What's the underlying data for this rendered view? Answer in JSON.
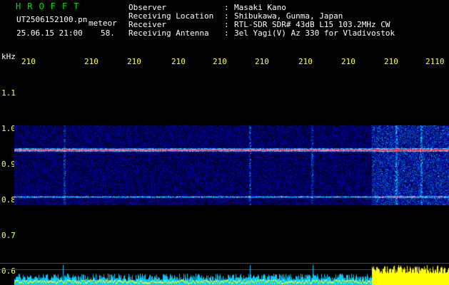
{
  "header": {
    "title": "HROFFT",
    "filename": "UT2506152100.pn",
    "meteor_label": "meteor",
    "datetime": "25.06.15 21:00",
    "count": "58."
  },
  "info": [
    {
      "label": "Observer",
      "value": "Masaki Kano"
    },
    {
      "label": "Receiving Location",
      "value": "Shibukawa, Gunma, Japan"
    },
    {
      "label": "Receiver",
      "value": "RTL-SDR SDR# 43dB L15 103.2MHz CW"
    },
    {
      "label": "Receiving Antenna",
      "value": "3el Yagi(V) Az 330 for Vladivostok"
    }
  ],
  "axis": {
    "unit": "kHz",
    "y_ticks": [
      "1.1",
      "1.0",
      "0.9",
      "0.8",
      "0.7",
      "0.6"
    ],
    "x_ticks": [
      "210",
      "210",
      "210",
      "210",
      "210",
      "210",
      "210",
      "210",
      "210",
      "2110"
    ]
  },
  "colors": {
    "background": "#000000",
    "tick_text": "#ffff55",
    "title": "#00e000",
    "text": "#ffffff",
    "histogram_low": "#00ccff",
    "histogram_high": "#ffff00",
    "grid": "#444444"
  }
}
